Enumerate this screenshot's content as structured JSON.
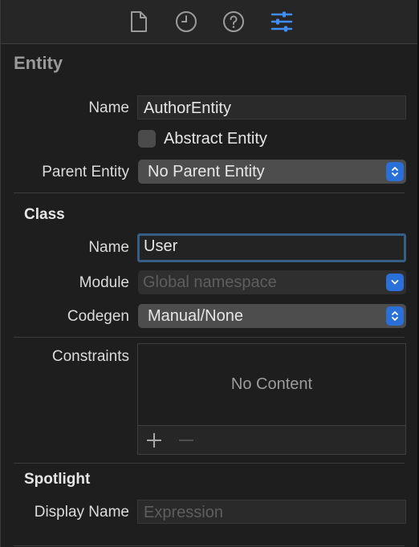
{
  "toolbar": {
    "icons": [
      "file-inspector-icon",
      "history-inspector-icon",
      "quick-help-icon",
      "attributes-inspector-icon"
    ],
    "active_index": 3,
    "accent_color": "#3d8ef7"
  },
  "entity": {
    "title": "Entity",
    "name_label": "Name",
    "name_value": "AuthorEntity",
    "abstract_label": "Abstract Entity",
    "abstract_checked": false,
    "parent_label": "Parent Entity",
    "parent_value": "No Parent Entity"
  },
  "class_section": {
    "title": "Class",
    "name_label": "Name",
    "name_value": "User",
    "module_label": "Module",
    "module_placeholder": "Global namespace",
    "codegen_label": "Codegen",
    "codegen_value": "Manual/None"
  },
  "constraints": {
    "label": "Constraints",
    "empty_text": "No Content",
    "add_symbol": "+",
    "remove_symbol": "−"
  },
  "spotlight": {
    "title": "Spotlight",
    "display_name_label": "Display Name",
    "display_name_placeholder": "Expression"
  }
}
